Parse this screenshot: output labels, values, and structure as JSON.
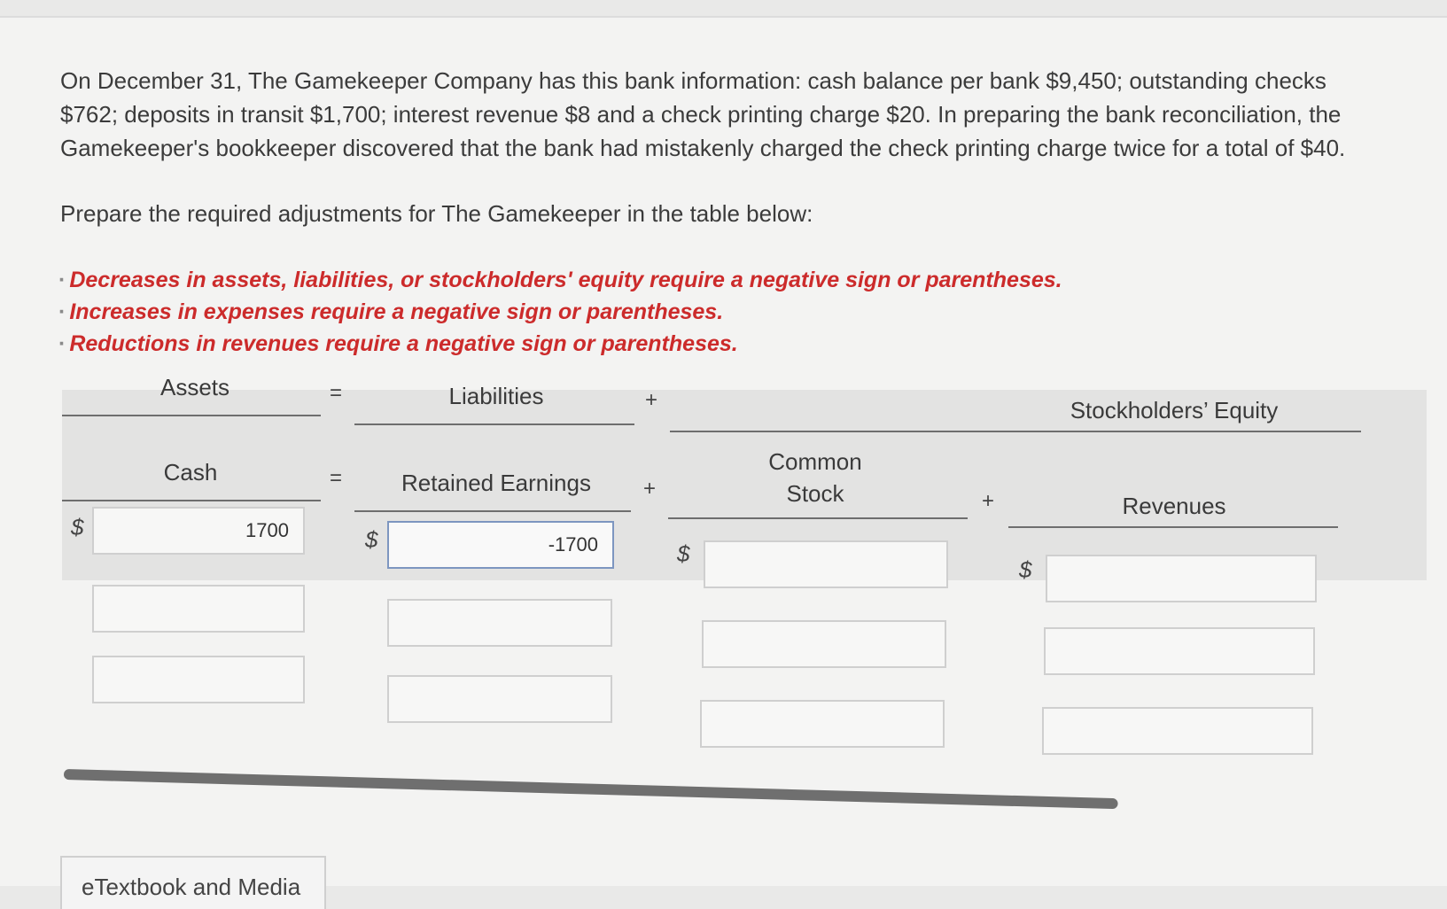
{
  "problem": {
    "text": "On December 31, The Gamekeeper Company has this bank information: cash balance per bank $9,450; outstanding checks $762; deposits in transit $1,700; interest revenue $8 and a check printing charge $20. In preparing the bank reconciliation, the Gamekeeper's bookkeeper discovered that the bank had mistakenly charged the check printing charge twice for a total of $40.",
    "prompt": "Prepare the required adjustments for The Gamekeeper in the table below:"
  },
  "rules": [
    "Decreases in assets, liabilities, or stockholders' equity require a negative sign or parentheses.",
    "Increases in expenses require a negative sign or parentheses.",
    "Reductions in revenues require a negative sign or parentheses."
  ],
  "worksheet": {
    "headers": {
      "assets": "Assets",
      "equals": "=",
      "liabilities": "Liabilities",
      "plus": "+",
      "stockholders_equity": "Stockholders’ Equity"
    },
    "subheaders": {
      "cash": "Cash",
      "equals": "=",
      "retained_earnings": "Retained Earnings",
      "plus": "+",
      "common_stock_line1": "Common",
      "common_stock_line2": "Stock",
      "plus2": "+",
      "revenues": "Revenues"
    },
    "currency_symbol": "$",
    "columns": {
      "cash": [
        "1700",
        "",
        ""
      ],
      "retained_earnings": [
        "-1700",
        "",
        ""
      ],
      "common_stock": [
        "",
        "",
        ""
      ],
      "revenues": [
        "",
        "",
        ""
      ]
    }
  },
  "footer": {
    "etextbook_label": "eTextbook and Media"
  }
}
